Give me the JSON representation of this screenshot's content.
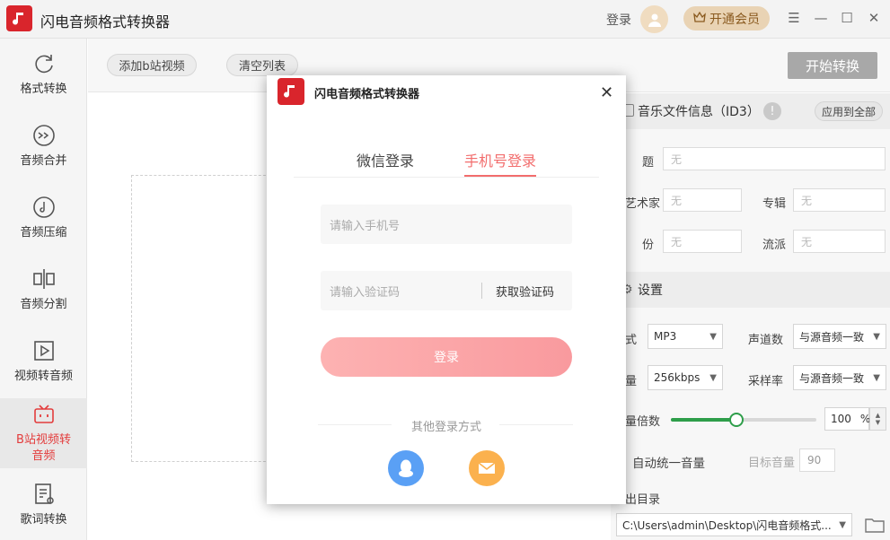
{
  "app": {
    "title": "闪电音频格式转换器"
  },
  "titlebar": {
    "login": "登录",
    "vip": "开通会员"
  },
  "sidebar": {
    "items": [
      {
        "label": "格式转换"
      },
      {
        "label": "音频合并"
      },
      {
        "label": "音频压缩"
      },
      {
        "label": "音频分割"
      },
      {
        "label": "视频转音频"
      },
      {
        "label_line1": "B站视频转",
        "label_line2": "音频"
      },
      {
        "label": "歌词转换"
      }
    ]
  },
  "toolbar": {
    "add": "添加b站视频",
    "clear": "清空列表",
    "start": "开始转换"
  },
  "id3": {
    "header": "音乐文件信息（ID3）",
    "apply_all": "应用到全部",
    "title_label": "题",
    "artist_label": "艺术家",
    "album_label": "专辑",
    "year_label": "份",
    "genre_label": "流派",
    "placeholder": "无"
  },
  "settings": {
    "header": "设置",
    "format_label": "式",
    "format_value": "MP3",
    "channels_label": "声道数",
    "channels_value": "与源音频一致",
    "bitrate_label": "量",
    "bitrate_value": "256kbps",
    "samplerate_label": "采样率",
    "samplerate_value": "与源音频一致",
    "volume_label": "量倍数",
    "volume_value": "100",
    "volume_unit": "%",
    "volume_level": 0.45,
    "normalize_label": "自动统一音量",
    "target_label": "目标音量",
    "target_value": "90",
    "output_label": "出目录",
    "output_path": "C:\\Users\\admin\\Desktop\\闪电音频格式..."
  },
  "modal": {
    "title": "闪电音频格式转换器",
    "tab_wechat": "微信登录",
    "tab_phone": "手机号登录",
    "phone_placeholder": "请输入手机号",
    "code_placeholder": "请输入验证码",
    "get_code": "获取验证码",
    "login": "登录",
    "other": "其他登录方式"
  },
  "colors": {
    "accent": "#f26d6d",
    "brand": "#d9252c",
    "qq": "#5aa0f5",
    "mail": "#fbb14e"
  }
}
